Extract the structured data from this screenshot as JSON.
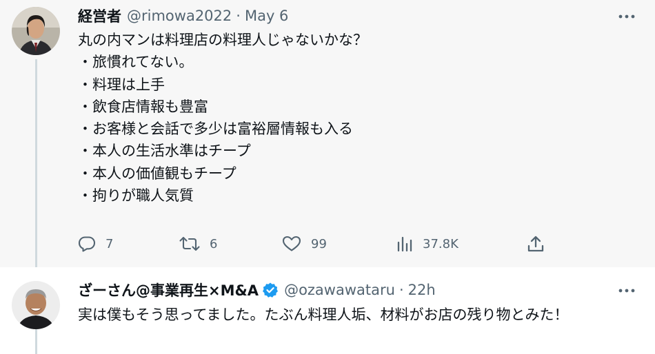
{
  "tweet1": {
    "display_name": "経営者",
    "handle": "@rimowa2022",
    "separator": "·",
    "time": "May 6",
    "lines": [
      "丸の内マンは料理店の料理人じゃないかな？",
      "・旅慣れてない。",
      "・料理は上手",
      "・飲食店情報も豊富",
      "・お客様と会話で多少は富裕層情報も入る",
      "・本人の生活水準はチープ",
      "・本人の価値観もチープ",
      "・拘りが職人気質"
    ],
    "stats": {
      "replies": "7",
      "retweets": "6",
      "likes": "99",
      "views": "37.8K"
    }
  },
  "tweet2": {
    "display_name": "ざーさん@事業再生×M&A",
    "handle": "@ozawawataru",
    "separator": "·",
    "time": "22h",
    "text": "実は僕もそう思ってました。たぶん料理人垢、材料がお店の残り物とみた！",
    "verified": true
  },
  "colors": {
    "text": "#0f1419",
    "secondary": "#536471",
    "verified_blue": "#1d9bf0",
    "thread_line": "#cfd9de",
    "highlight_bg": "#f7f7f7"
  },
  "icons": {
    "reply": "reply-icon",
    "retweet": "retweet-icon",
    "like": "heart-icon",
    "views": "views-icon",
    "share": "share-icon",
    "more": "more-icon",
    "verified": "verified-badge-icon"
  }
}
